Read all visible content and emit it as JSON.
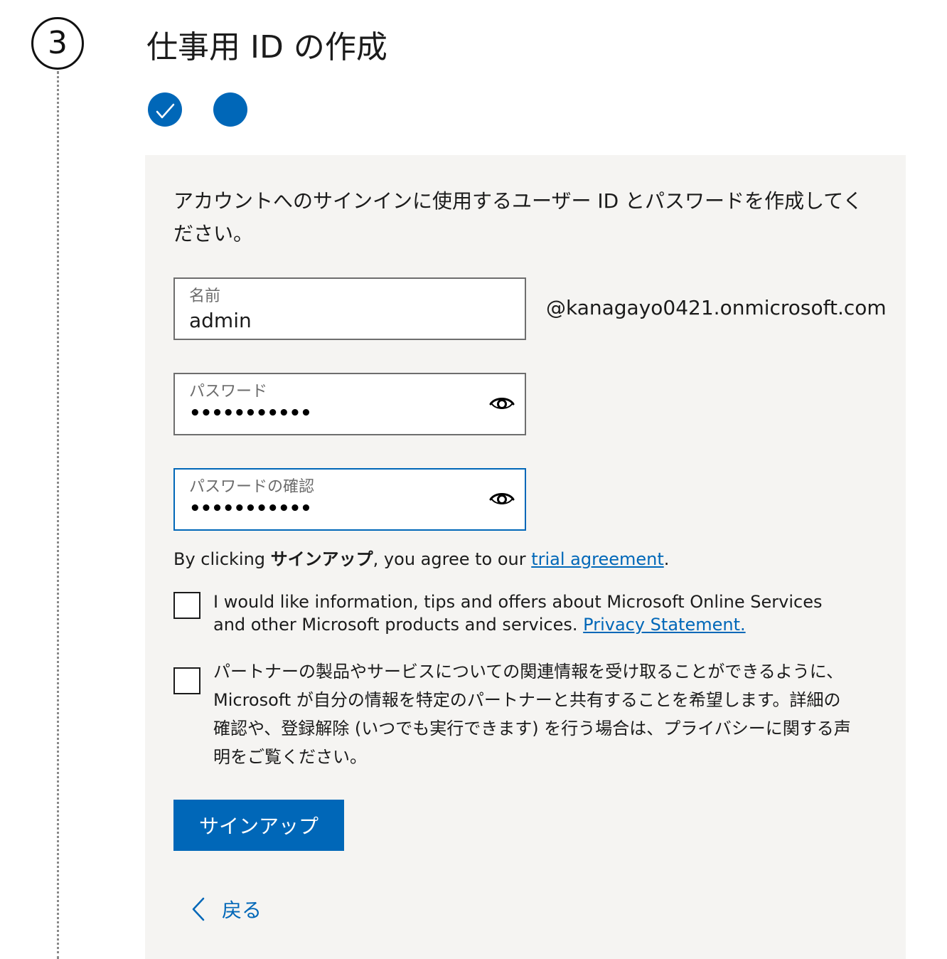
{
  "step": {
    "number": "3"
  },
  "title": "仕事用 ID の作成",
  "intro_text": "アカウントへのサインインに使用するユーザー ID とパスワードを作成してください。",
  "fields": {
    "name": {
      "label": "名前",
      "value": "admin"
    },
    "domain_suffix": "@kanagayo0421.onmicrosoft.com",
    "password": {
      "label": "パスワード",
      "masked_value": "•••••••••••"
    },
    "confirm_password": {
      "label": "パスワードの確認",
      "masked_value": "•••••••••••"
    }
  },
  "agreement": {
    "prefix": "By clicking ",
    "bold": "サインアップ",
    "middle": ", you agree to our ",
    "link": "trial agreement",
    "suffix": "."
  },
  "checkboxes": [
    {
      "text": "I would like information, tips and offers about Microsoft Online Services and other Microsoft products and services. ",
      "link": "Privacy Statement.",
      "checked": false
    },
    {
      "text": "パートナーの製品やサービスについての関連情報を受け取ることができるように、Microsoft が自分の情報を特定のパートナーと共有することを希望します。詳細の確認や、登録解除 (いつでも実行できます) を行う場合は、プライバシーに関する声明をご覧ください。",
      "checked": false
    }
  ],
  "buttons": {
    "signup": "サインアップ",
    "back": "戻る"
  },
  "icons": {
    "progress": [
      "check-icon",
      "current-step-icon"
    ],
    "password_toggle": "eye-icon",
    "back": "chevron-left-icon"
  },
  "colors": {
    "accent": "#0067b8",
    "card_background": "#f5f4f2"
  }
}
